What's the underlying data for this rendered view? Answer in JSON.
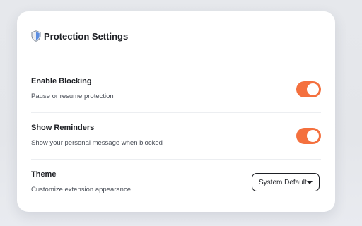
{
  "settings": {
    "title": "Protection Settings",
    "icon": "shield-icon",
    "accent_color": "#f4703e",
    "items": [
      {
        "label": "Enable Blocking",
        "description": "Pause or resume protection",
        "control": "toggle",
        "enabled": true
      },
      {
        "label": "Show Reminders",
        "description": "Show your personal message when blocked",
        "control": "toggle",
        "enabled": true
      },
      {
        "label": "Theme",
        "description": "Customize extension appearance",
        "control": "select",
        "selected": "System Default"
      }
    ]
  }
}
